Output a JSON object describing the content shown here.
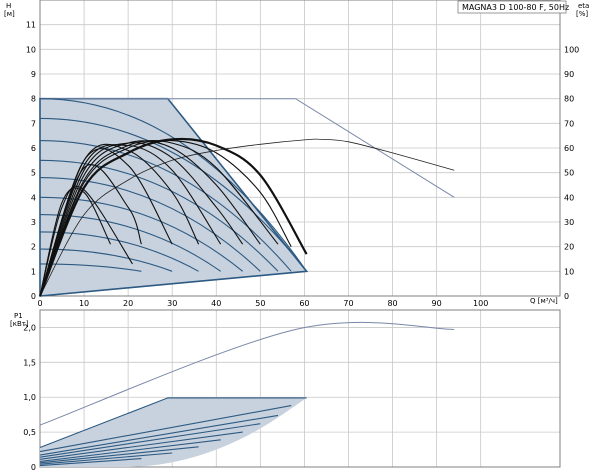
{
  "chart_data": [
    {
      "type": "line",
      "title": "MAGNA3 D 100-80 F, 50Hz",
      "xlabel": "Q [м³/ч]",
      "ylabel_left": "H",
      "ylabel_left_unit": "[м]",
      "ylabel_right": "eta",
      "ylabel_right_unit": "[%]",
      "xlim": [
        0,
        118
      ],
      "ylim_left": [
        0,
        12
      ],
      "ylim_right": [
        0,
        120
      ],
      "x_ticks": [
        "0",
        "10",
        "20",
        "30",
        "40",
        "50",
        "60",
        "70",
        "80",
        "90",
        "100"
      ],
      "x_tick_values": [
        0,
        10,
        20,
        30,
        40,
        50,
        60,
        70,
        80,
        90,
        100
      ],
      "y_left_ticks": [
        "0",
        "1",
        "2",
        "3",
        "4",
        "5",
        "6",
        "7",
        "8",
        "9",
        "10",
        "11"
      ],
      "y_left_tick_values": [
        0,
        1,
        2,
        3,
        4,
        5,
        6,
        7,
        8,
        9,
        10,
        11
      ],
      "y_right_ticks": [
        "0",
        "10",
        "20",
        "30",
        "40",
        "50",
        "60",
        "70",
        "80",
        "90",
        "100"
      ],
      "y_right_tick_values": [
        0,
        10,
        20,
        30,
        40,
        50,
        60,
        70,
        80,
        90,
        100
      ],
      "grid": true,
      "operating_area": [
        [
          0,
          8
        ],
        [
          29,
          8
        ],
        [
          60.5,
          1.0
        ],
        [
          0,
          0
        ]
      ],
      "series": [
        {
          "role": "max-head",
          "values_x": [
            0,
            58,
            94
          ],
          "values_y": [
            8,
            8,
            4.0
          ]
        },
        {
          "role": "head-curve",
          "values_x": [
            0,
            29,
            60.5
          ],
          "values_y": [
            8,
            8,
            1.0
          ]
        },
        {
          "role": "head-curve",
          "values_x": [
            0,
            60.5
          ],
          "values_y": [
            7.2,
            1.0
          ]
        },
        {
          "role": "head-curve",
          "values_x": [
            0,
            57
          ],
          "values_y": [
            6.3,
            1.0
          ]
        },
        {
          "role": "head-curve",
          "values_x": [
            0,
            54
          ],
          "values_y": [
            5.5,
            1.0
          ]
        },
        {
          "role": "head-curve",
          "values_x": [
            0,
            50
          ],
          "values_y": [
            4.8,
            1.0
          ]
        },
        {
          "role": "head-curve",
          "values_x": [
            0,
            46
          ],
          "values_y": [
            4.0,
            1.0
          ]
        },
        {
          "role": "head-curve",
          "values_x": [
            0,
            41
          ],
          "values_y": [
            3.3,
            1.0
          ]
        },
        {
          "role": "head-curve",
          "values_x": [
            0,
            36
          ],
          "values_y": [
            2.6,
            1.0
          ]
        },
        {
          "role": "head-curve",
          "values_x": [
            0,
            30
          ],
          "values_y": [
            1.9,
            1.0
          ]
        },
        {
          "role": "head-curve",
          "values_x": [
            0,
            23
          ],
          "values_y": [
            1.3,
            1.0
          ]
        },
        {
          "role": "eta-max",
          "values_x": [
            0,
            10,
            20,
            30,
            40,
            50,
            60,
            64,
            70,
            80,
            94
          ],
          "values_y": [
            0,
            33,
            47,
            55,
            59,
            61.5,
            63.3,
            63.5,
            62.5,
            58,
            51
          ]
        },
        {
          "role": "eta-curve",
          "values_x": [
            0,
            10,
            20,
            30,
            40,
            50,
            60.5
          ],
          "values_y": [
            0,
            44,
            58,
            63.5,
            61,
            49,
            17
          ]
        },
        {
          "role": "eta-curve",
          "values_x": [
            0,
            10,
            20,
            30,
            40,
            50,
            57
          ],
          "values_y": [
            0,
            46,
            60,
            63,
            58,
            42,
            20
          ]
        },
        {
          "role": "eta-curve",
          "values_x": [
            0,
            10,
            20,
            30,
            40,
            54
          ],
          "values_y": [
            0,
            47,
            61,
            62,
            52,
            21
          ]
        },
        {
          "role": "eta-curve",
          "values_x": [
            0,
            10,
            20,
            30,
            40,
            50
          ],
          "values_y": [
            0,
            49,
            62,
            60,
            45,
            21
          ]
        },
        {
          "role": "eta-curve",
          "values_x": [
            0,
            10,
            20,
            30,
            40,
            46
          ],
          "values_y": [
            0,
            51,
            62,
            56,
            36,
            21
          ]
        },
        {
          "role": "eta-curve",
          "values_x": [
            0,
            10,
            20,
            30,
            41
          ],
          "values_y": [
            0,
            53,
            61,
            51,
            21
          ]
        },
        {
          "role": "eta-curve",
          "values_x": [
            0,
            10,
            20,
            30,
            36
          ],
          "values_y": [
            0,
            55,
            59,
            42,
            21
          ]
        },
        {
          "role": "eta-curve",
          "values_x": [
            0,
            10,
            20,
            30
          ],
          "values_y": [
            0,
            55,
            53,
            21
          ]
        },
        {
          "role": "eta-curve",
          "values_x": [
            0,
            10,
            20,
            23
          ],
          "values_y": [
            0,
            52,
            36,
            21
          ]
        },
        {
          "role": "eta-curve",
          "values_x": [
            0,
            5,
            10,
            16
          ],
          "values_y": [
            0,
            38,
            42,
            21
          ]
        },
        {
          "role": "eta-curve",
          "values_x": [
            0,
            5,
            10,
            21
          ],
          "values_y": [
            0,
            36,
            43,
            13
          ]
        }
      ]
    },
    {
      "type": "line",
      "xlabel": "",
      "ylabel": "P1",
      "ylabel_unit": "[кВт]",
      "xlim": [
        0,
        118
      ],
      "ylim": [
        0,
        2.25
      ],
      "y_ticks": [
        "0",
        "0,5",
        "1,0",
        "1,5",
        "2,0"
      ],
      "y_tick_values": [
        0,
        0.5,
        1.0,
        1.5,
        2.0
      ],
      "grid": true,
      "operating_area": [
        [
          0,
          0.28
        ],
        [
          29,
          0.9
        ],
        [
          60.5,
          0.98
        ],
        [
          60.5,
          0.98
        ],
        [
          0,
          0.02
        ]
      ],
      "series": [
        {
          "role": "power-max",
          "values_x": [
            0,
            58,
            94
          ],
          "values_y": [
            0.6,
            1.97,
            1.97
          ]
        },
        {
          "role": "power-curve",
          "values_x": [
            0,
            29,
            60.5
          ],
          "values_y": [
            0.28,
            0.99,
            0.99
          ]
        },
        {
          "role": "power-curve",
          "values_x": [
            0,
            57
          ],
          "values_y": [
            0.22,
            0.88
          ]
        },
        {
          "role": "power-curve",
          "values_x": [
            0,
            54
          ],
          "values_y": [
            0.17,
            0.74
          ]
        },
        {
          "role": "power-curve",
          "values_x": [
            0,
            50
          ],
          "values_y": [
            0.14,
            0.62
          ]
        },
        {
          "role": "power-curve",
          "values_x": [
            0,
            46
          ],
          "values_y": [
            0.11,
            0.5
          ]
        },
        {
          "role": "power-curve",
          "values_x": [
            0,
            41
          ],
          "values_y": [
            0.08,
            0.39
          ]
        },
        {
          "role": "power-curve",
          "values_x": [
            0,
            36
          ],
          "values_y": [
            0.06,
            0.29
          ]
        },
        {
          "role": "power-curve",
          "values_x": [
            0,
            30
          ],
          "values_y": [
            0.04,
            0.2
          ]
        },
        {
          "role": "power-curve",
          "values_x": [
            0,
            23
          ],
          "values_y": [
            0.02,
            0.12
          ]
        }
      ]
    }
  ],
  "colors": {
    "fill": "#c8d2de",
    "curve_blue": "#2d5a82",
    "max_line": "#7a87a8",
    "eta_black": "#111111"
  }
}
